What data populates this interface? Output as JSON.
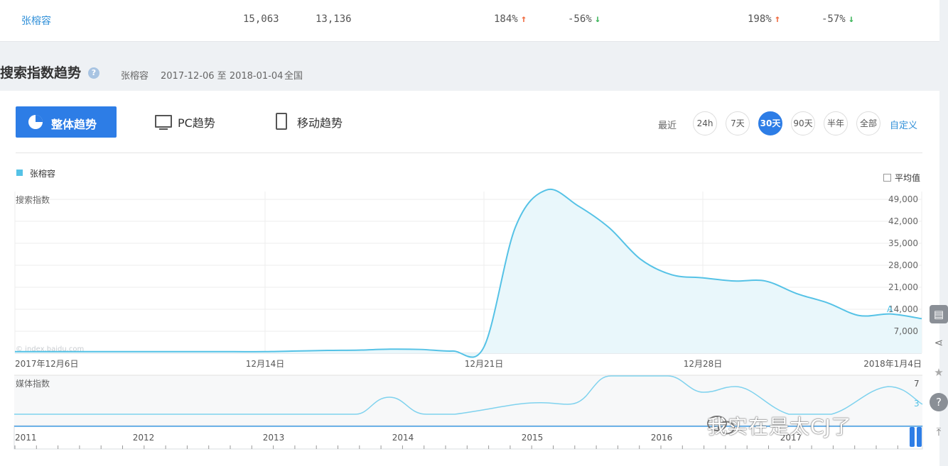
{
  "top_row": {
    "name": "张榕容",
    "v1": "15,063",
    "v2": "13,136",
    "p1": "184%",
    "p2": "-56%",
    "p3": "198%",
    "p4": "-57%"
  },
  "section": {
    "title": "搜索指数趋势",
    "help_icon": "?",
    "keyword": "张榕容",
    "date_range": "2017-12-06 至 2018-01-04",
    "region": "全国"
  },
  "tabs": {
    "overall": "整体趋势",
    "pc": "PC趋势",
    "mobile": "移动趋势"
  },
  "range": {
    "label": "最近",
    "options": [
      "24h",
      "7天",
      "30天",
      "90天",
      "半年",
      "全部"
    ],
    "active": "30天",
    "custom": "自定义"
  },
  "legend": {
    "series_name": "张榕容",
    "avg_label": "平均值",
    "color": "#55c2e6"
  },
  "chart_data": [
    {
      "type": "area",
      "title": "搜索指数",
      "watermark": "© index.baidu.com",
      "x_labels": [
        "2017年12月6日",
        "12月14日",
        "12月21日",
        "12月28日",
        "2018年1月4日"
      ],
      "y_ticks": [
        "7,000",
        "14,000",
        "21,000",
        "28,000",
        "35,000",
        "42,000",
        "49,000"
      ],
      "ylim": [
        0,
        51500
      ],
      "annotation": "A",
      "series": [
        {
          "name": "张榕容",
          "dates": [
            "2017-12-06",
            "2017-12-07",
            "2017-12-08",
            "2017-12-09",
            "2017-12-10",
            "2017-12-11",
            "2017-12-12",
            "2017-12-13",
            "2017-12-14",
            "2017-12-15",
            "2017-12-16",
            "2017-12-17",
            "2017-12-18",
            "2017-12-19",
            "2017-12-20",
            "2017-12-21",
            "2017-12-22",
            "2017-12-23",
            "2017-12-24",
            "2017-12-25",
            "2017-12-26",
            "2017-12-27",
            "2017-12-28",
            "2017-12-29",
            "2017-12-30",
            "2017-12-31",
            "2018-01-01",
            "2018-01-02",
            "2018-01-03",
            "2018-01-04"
          ],
          "values": [
            500,
            500,
            500,
            500,
            500,
            500,
            500,
            500,
            500,
            700,
            900,
            1000,
            1300,
            1200,
            700,
            2000,
            40000,
            52000,
            47000,
            40000,
            30000,
            25000,
            24000,
            23000,
            23000,
            19000,
            16000,
            12000,
            12500,
            11000
          ]
        }
      ]
    },
    {
      "type": "area",
      "title": "媒体指数",
      "y_ticks": [
        "7",
        "3"
      ],
      "x_labels": [
        "2011",
        "2012",
        "2013",
        "2014",
        "2015",
        "2016",
        "2017"
      ]
    }
  ]
}
